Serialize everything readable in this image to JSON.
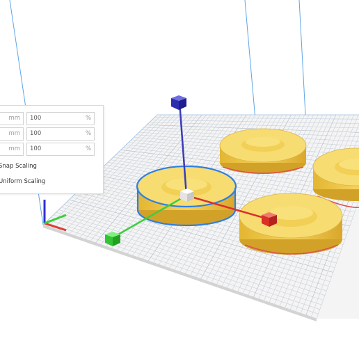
{
  "scale_panel": {
    "rows": [
      {
        "mm_value": "",
        "mm_unit": "mm",
        "pct_value": "100",
        "pct_unit": "%"
      },
      {
        "mm_value": "",
        "mm_unit": "mm",
        "pct_value": "100",
        "pct_unit": "%"
      },
      {
        "mm_value": "",
        "mm_unit": "mm",
        "pct_value": "100",
        "pct_unit": "%"
      }
    ],
    "snap_scaling_label": "Snap Scaling",
    "uniform_scaling_label": "Uniform Scaling"
  },
  "colors": {
    "model_fill": "#f6d86a",
    "model_edge": "#c99c28",
    "selection_outline": "#2f7fe0",
    "build_plate": "#f4f4f4",
    "grid_line": "#c9d0da",
    "volume_line": "#5ea5e6",
    "axis_x": "#d9302c",
    "axis_y": "#3ccf3c",
    "axis_z": "#3b3bb8"
  },
  "icons": {
    "scale_handle_x": "red-cube-handle",
    "scale_handle_y": "green-cube-handle",
    "scale_handle_z": "blue-cube-handle",
    "scale_center": "white-cube-handle"
  }
}
